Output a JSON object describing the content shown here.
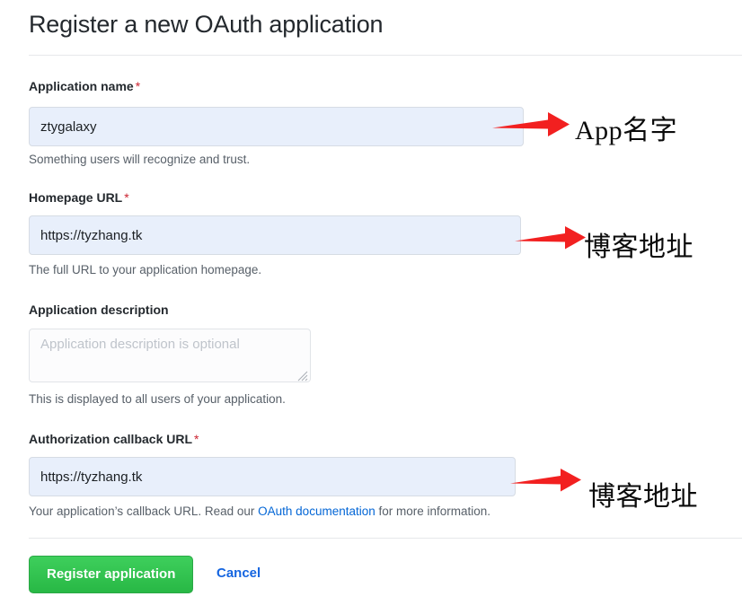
{
  "page": {
    "title": "Register a new OAuth application"
  },
  "form": {
    "fields": [
      {
        "label": "Application name",
        "required": true,
        "required_marker": "*",
        "value": "ztygalaxy",
        "placeholder": "",
        "help": "Something users will recognize and trust."
      },
      {
        "label": "Homepage URL",
        "required": true,
        "required_marker": "*",
        "value": "https://tyzhang.tk",
        "placeholder": "",
        "help": "The full URL to your application homepage."
      },
      {
        "label": "Application description",
        "required": false,
        "required_marker": "",
        "value": "",
        "placeholder": "Application description is optional",
        "help": "This is displayed to all users of your application."
      },
      {
        "label": "Authorization callback URL",
        "required": true,
        "required_marker": "*",
        "value": "https://tyzhang.tk",
        "placeholder": "",
        "help_prefix": "Your application’s callback URL. Read our ",
        "help_link": "OAuth documentation",
        "help_suffix": " for more information."
      }
    ]
  },
  "actions": {
    "submit_label": "Register application",
    "cancel_label": "Cancel"
  },
  "annotations": [
    {
      "text": "App名字"
    },
    {
      "text": "博客地址"
    },
    {
      "text": "博客地址"
    }
  ],
  "colors": {
    "accent_green": "#2eb84a",
    "link_blue": "#0366d6",
    "required_red": "#cb2431",
    "annotation_red": "#f22020",
    "input_fill": "#e8effb",
    "text_dark": "#24292e",
    "text_muted": "#586069"
  }
}
